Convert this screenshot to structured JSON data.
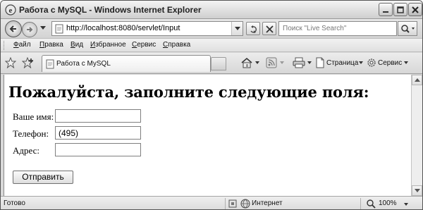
{
  "window": {
    "title": "Работа с MySQL - Windows Internet Explorer"
  },
  "address": {
    "url": "http://localhost:8080/servlet/Input"
  },
  "search": {
    "placeholder": "Поиск \"Live Search\""
  },
  "menu": {
    "items": [
      "Файл",
      "Правка",
      "Вид",
      "Избранное",
      "Сервис",
      "Справка"
    ]
  },
  "tabs": {
    "active_label": "Работа с MySQL"
  },
  "commands": {
    "page_label": "Страница",
    "tools_label": "Сервис"
  },
  "page": {
    "heading": "Пожалуйста, заполните следующие поля:",
    "fields": [
      {
        "label": "Ваше имя:",
        "value": ""
      },
      {
        "label": "Телефон:",
        "value": "(495)"
      },
      {
        "label": "Адрес:",
        "value": ""
      }
    ],
    "submit_label": "Отправить"
  },
  "status": {
    "text": "Готово",
    "zone": "Интернет",
    "zoom": "100%"
  },
  "icons": {
    "app": "ie-icon",
    "back": "back-arrow-icon",
    "forward": "forward-arrow-icon",
    "refresh": "refresh-icon",
    "stop": "stop-icon",
    "search": "magnifier-icon",
    "favorites": "star-icon",
    "add_favorites": "add-favorite-icon",
    "home": "home-icon",
    "feeds": "rss-icon",
    "print": "printer-icon",
    "page": "page-icon",
    "tools": "gear-icon",
    "zone": "globe-icon"
  }
}
